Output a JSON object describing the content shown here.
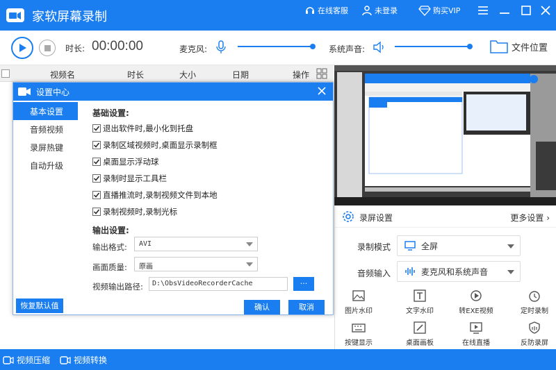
{
  "app": {
    "title": "家软屏幕录制"
  },
  "titlebar": {
    "service_label": "在线客服",
    "login_label": "未登录",
    "vip_label": "购买VIP"
  },
  "toolbar": {
    "duration_label": "时长:",
    "duration_value": "00:00:00",
    "mic_label": "麦克风:",
    "system_sound_label": "系统声音:",
    "file_location_label": "文件位置",
    "mic_volume": 0.9,
    "system_volume": 0.9
  },
  "file_list": {
    "columns": [
      "视频名",
      "时长",
      "大小",
      "日期",
      "操作"
    ]
  },
  "right_panel": {
    "title": "录屏设置",
    "more_label": "更多设置",
    "record_mode_label": "录制模式",
    "record_mode_value": "全屏",
    "audio_input_label": "音频输入",
    "audio_input_value": "麦克风和系统声音",
    "tools": [
      {
        "label": "图片水印",
        "icon": "image-icon"
      },
      {
        "label": "文字水印",
        "icon": "text-icon"
      },
      {
        "label": "转EXE视频",
        "icon": "convert-icon"
      },
      {
        "label": "定时录制",
        "icon": "alarm-icon"
      },
      {
        "label": "按键显示",
        "icon": "keyboard-icon"
      },
      {
        "label": "桌面画板",
        "icon": "pen-icon"
      },
      {
        "label": "在线直播",
        "icon": "live-icon"
      },
      {
        "label": "反防录屏",
        "icon": "shield-icon"
      }
    ]
  },
  "bottombar": {
    "compress_label": "视频压缩",
    "convert_label": "视频转换"
  },
  "dialog": {
    "title": "设置中心",
    "nav": [
      "基本设置",
      "音频视频",
      "录屏热键",
      "自动升级"
    ],
    "basic_title": "基础设置:",
    "options": [
      "退出软件时,最小化到托盘",
      "录制区域视频时,桌面显示录制框",
      "桌面显示浮动球",
      "录制时显示工具栏",
      "直播推流时,录制视频文件到本地",
      "录制视频时,录制光标"
    ],
    "output_title": "输出设置:",
    "format_label": "输出格式:",
    "format_value": "AVI",
    "quality_label": "画面质量:",
    "quality_value": "原画",
    "path_label": "视频输出路径:",
    "path_value": "D:\\ObsVideoRecorderCache",
    "browse_label": "...",
    "restore_label": "恢复默认值",
    "ok_label": "确认",
    "cancel_label": "取消"
  },
  "colors": {
    "accent": "#1a7ef0"
  }
}
